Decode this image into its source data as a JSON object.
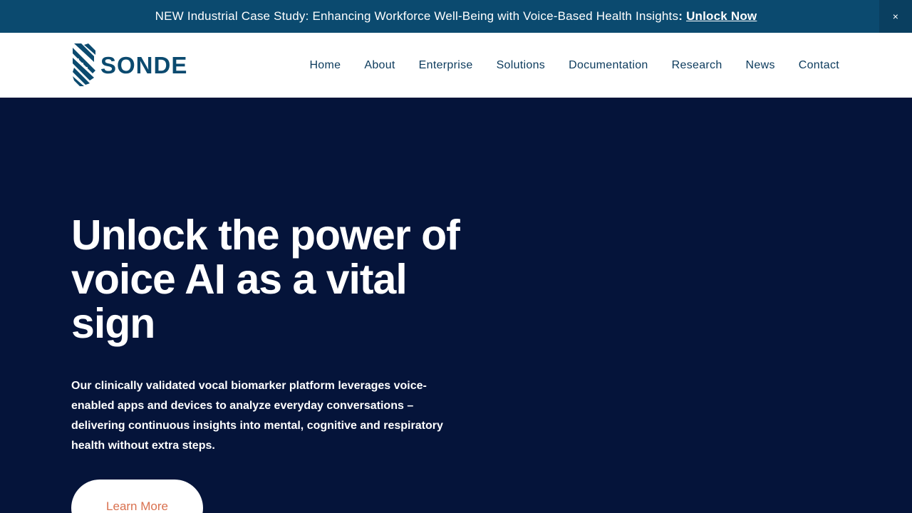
{
  "announcement": {
    "text": "NEW Industrial Case Study: Enhancing Workforce Well-Being with Voice-Based Health Insights",
    "colon": ":",
    "link_label": "Unlock Now",
    "close_glyph": "×"
  },
  "header": {
    "logo_text": "SONDE",
    "nav": [
      "Home",
      "About",
      "Enterprise",
      "Solutions",
      "Documentation",
      "Research",
      "News",
      "Contact"
    ]
  },
  "hero": {
    "headline": "Unlock the power of voice AI as a vital sign",
    "description": "Our clinically validated vocal biomarker platform leverages voice-enabled apps and devices to analyze everyday conversations – delivering continuous insights into mental, cognitive and respiratory health without extra steps.",
    "cta_label": "Learn More"
  },
  "colors": {
    "announcement_bg": "#0b4a6f",
    "hero_bg": "#05143a",
    "brand": "#0b4a6f",
    "cta_text": "#d9714f"
  }
}
